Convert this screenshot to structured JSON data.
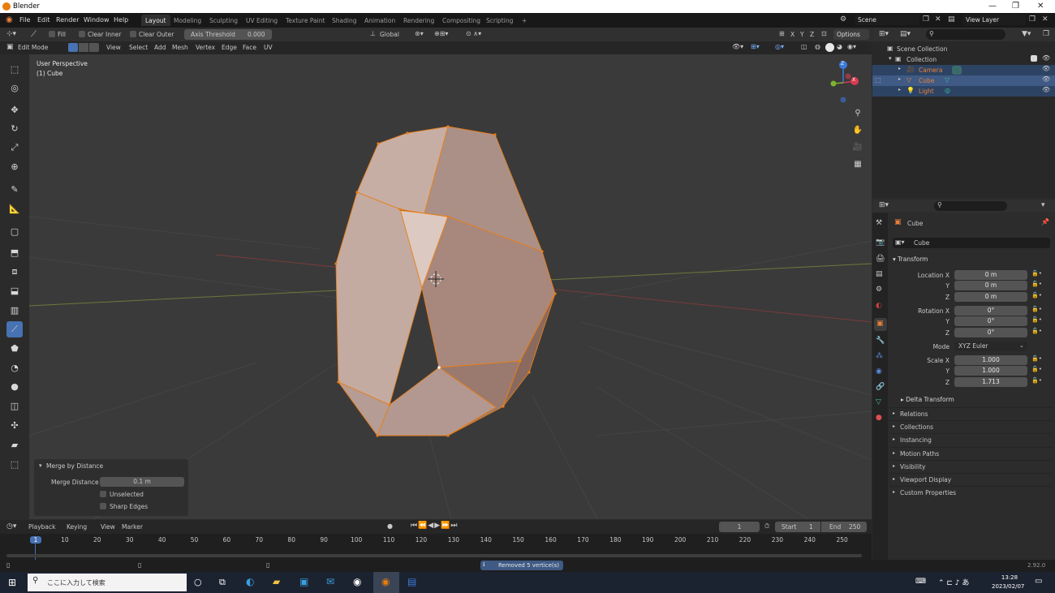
{
  "window": {
    "title": "Blender"
  },
  "topbar": {
    "menus": [
      "File",
      "Edit",
      "Render",
      "Window",
      "Help"
    ],
    "workspaces": [
      "Layout",
      "Modeling",
      "Sculpting",
      "UV Editing",
      "Texture Paint",
      "Shading",
      "Animation",
      "Rendering",
      "Compositing",
      "Scripting"
    ],
    "add_workspace": "+",
    "scene": "Scene",
    "view_layer": "View Layer"
  },
  "tool_header": {
    "fill": "Fill",
    "clear_inner": "Clear Inner",
    "clear_outer": "Clear Outer",
    "axis_threshold_label": "Axis Threshold",
    "axis_threshold_value": "0.000",
    "orientation": "Global",
    "axes": [
      "X",
      "Y",
      "Z"
    ],
    "options": "Options"
  },
  "mode_header": {
    "mode": "Edit Mode",
    "menus": [
      "View",
      "Select",
      "Add",
      "Mesh",
      "Vertex",
      "Edge",
      "Face",
      "UV"
    ]
  },
  "viewport": {
    "perspective": "User Perspective",
    "object": "(1) Cube",
    "gizmo": {
      "x": "X",
      "y": "Y",
      "z": "Z"
    }
  },
  "redo_panel": {
    "title": "Merge by Distance",
    "merge_distance_label": "Merge Distance",
    "merge_distance_value": "0.1 m",
    "unselected": "Unselected",
    "sharp_edges": "Sharp Edges"
  },
  "timeline": {
    "menus": [
      "Playback",
      "Keying",
      "View",
      "Marker"
    ],
    "current_frame": "1",
    "start_label": "Start",
    "start_value": "1",
    "end_label": "End",
    "end_value": "250",
    "ruler": [
      "1",
      "10",
      "20",
      "30",
      "40",
      "50",
      "60",
      "70",
      "80",
      "90",
      "100",
      "110",
      "120",
      "130",
      "140",
      "150",
      "160",
      "170",
      "180",
      "190",
      "200",
      "210",
      "220",
      "230",
      "240",
      "250"
    ]
  },
  "outliner": {
    "scene_collection": "Scene Collection",
    "collection": "Collection",
    "items": [
      {
        "name": "Camera",
        "color": "#e8813a"
      },
      {
        "name": "Cube",
        "color": "#e8813a"
      },
      {
        "name": "Light",
        "color": "#e8813a"
      }
    ]
  },
  "properties": {
    "object_name": "Cube",
    "object_field": "Cube",
    "transform": "Transform",
    "location": {
      "label": "Location X",
      "x": "0 m",
      "y": "0 m",
      "z": "0 m"
    },
    "rotation": {
      "label": "Rotation X",
      "x": "0°",
      "y": "0°",
      "z": "0°"
    },
    "mode_label": "Mode",
    "mode_value": "XYZ Euler",
    "scale": {
      "label": "Scale X",
      "x": "1.000",
      "y": "1.000",
      "z": "1.713"
    },
    "axis_y": "Y",
    "axis_z": "Z",
    "delta_transform": "Delta Transform",
    "panels": [
      "Relations",
      "Collections",
      "Instancing",
      "Motion Paths",
      "Visibility",
      "Viewport Display",
      "Custom Properties"
    ]
  },
  "status": {
    "message": "Removed 5 vertice(s)",
    "version": "2.92.0"
  },
  "taskbar": {
    "search_placeholder": "ここに入力して検索",
    "time": "13:28",
    "date": "2023/02/07"
  },
  "colors": {
    "accent": "#4772b3",
    "selection": "#e8813a",
    "mesh_face": "#c8a99a"
  }
}
